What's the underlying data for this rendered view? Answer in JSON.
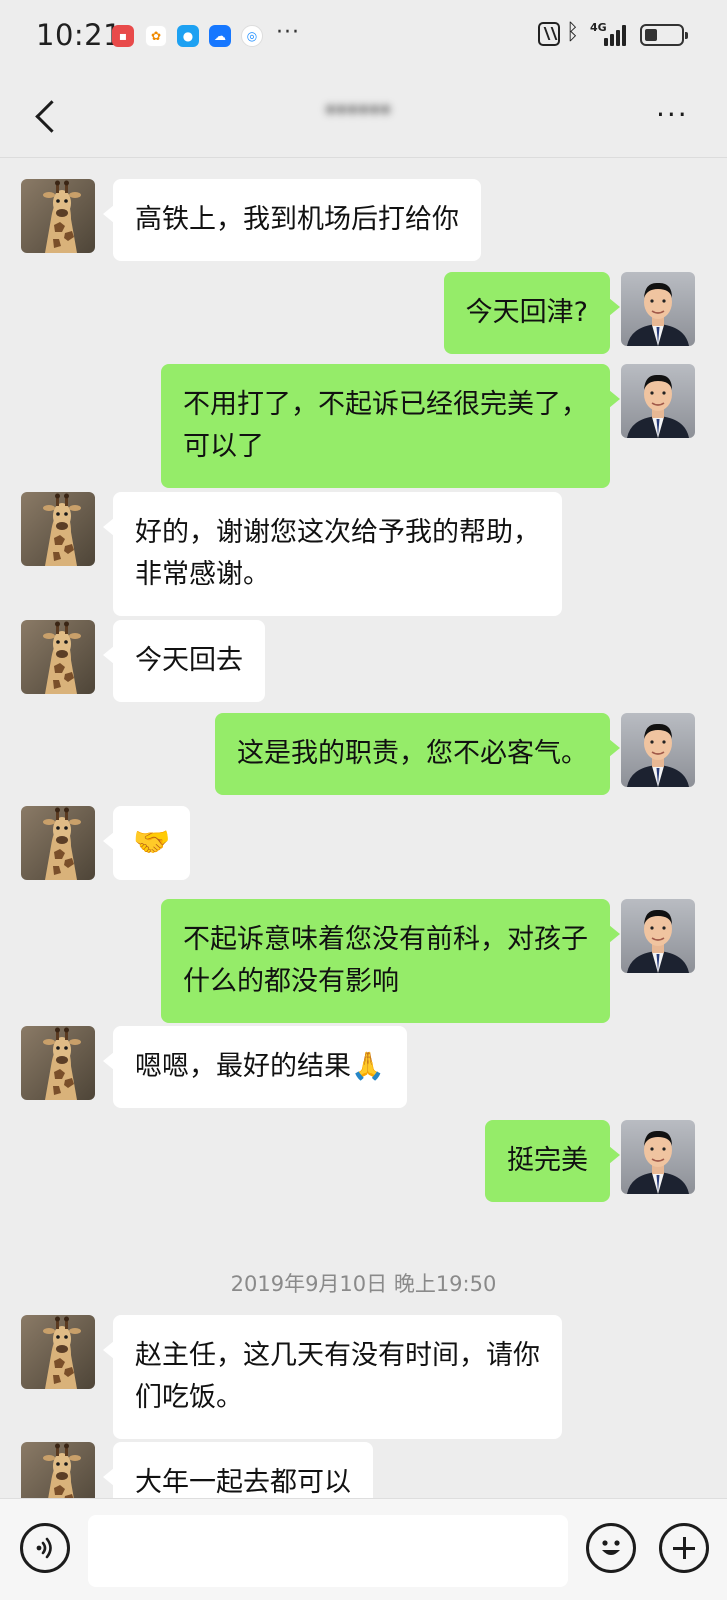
{
  "status_bar": {
    "time": "10:21",
    "network": "4G",
    "notification_icons": [
      "huawei-store-icon",
      "app-icon",
      "messenger-icon",
      "cloud-icon",
      "browser-icon"
    ],
    "more_notifications": "···"
  },
  "header": {
    "title": "******",
    "more": "···"
  },
  "messages": [
    {
      "from": "contact",
      "text": "高铁上，我到机场后打给你"
    },
    {
      "from": "me",
      "text": "今天回津?"
    },
    {
      "from": "me",
      "text": "不用打了，不起诉已经很完美了，\n可以了"
    },
    {
      "from": "contact",
      "text": "好的，谢谢您这次给予我的帮助，\n非常感谢。"
    },
    {
      "from": "contact",
      "text": "今天回去"
    },
    {
      "from": "me",
      "text": "这是我的职责，您不必客气。"
    },
    {
      "from": "contact",
      "text": "🤝"
    },
    {
      "from": "me",
      "text": "不起诉意味着您没有前科，对孩子\n什么的都没有影响"
    },
    {
      "from": "contact",
      "text": "嗯嗯，最好的结果🙏"
    },
    {
      "from": "me",
      "text": "挺完美"
    },
    {
      "from": "contact",
      "text": "赵主任，这几天有没有时间，请你\n们吃饭。"
    },
    {
      "from": "contact",
      "text": "大年一起去都可以"
    }
  ],
  "timestamp": "2019年9月10日 晚上19:50",
  "input_bar": {
    "placeholder": ""
  },
  "colors": {
    "background": "#ededed",
    "incoming_bubble": "#ffffff",
    "outgoing_bubble": "#95ec69"
  }
}
